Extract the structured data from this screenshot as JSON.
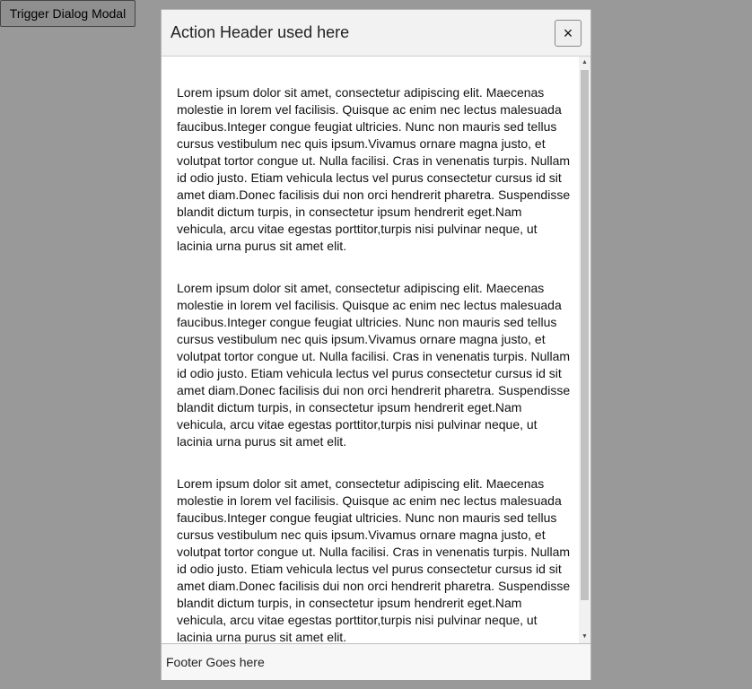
{
  "page": {
    "trigger_label": "Trigger Dialog Modal"
  },
  "modal": {
    "title": "Action Header used here",
    "close_icon": "×",
    "paragraphs": [
      "Lorem ipsum dolor sit amet, consectetur adipiscing elit. Maecenas molestie in lorem vel facilisis. Quisque ac enim nec lectus malesuada faucibus.Integer congue feugiat ultricies. Nunc non mauris sed tellus cursus vestibulum nec quis ipsum.Vivamus ornare magna justo, et volutpat tortor congue ut. Nulla facilisi. Cras in venenatis turpis. Nullam id odio justo. Etiam vehicula lectus vel purus consectetur cursus id sit amet diam.Donec facilisis dui non orci hendrerit pharetra. Suspendisse blandit dictum turpis, in consectetur ipsum hendrerit eget.Nam vehicula, arcu vitae egestas porttitor,turpis nisi pulvinar neque, ut lacinia urna purus sit amet elit.",
      "Lorem ipsum dolor sit amet, consectetur adipiscing elit. Maecenas molestie in lorem vel facilisis. Quisque ac enim nec lectus malesuada faucibus.Integer congue feugiat ultricies. Nunc non mauris sed tellus cursus vestibulum nec quis ipsum.Vivamus ornare magna justo, et volutpat tortor congue ut. Nulla facilisi. Cras in venenatis turpis. Nullam id odio justo. Etiam vehicula lectus vel purus consectetur cursus id sit amet diam.Donec facilisis dui non orci hendrerit pharetra. Suspendisse blandit dictum turpis, in consectetur ipsum hendrerit eget.Nam vehicula, arcu vitae egestas porttitor,turpis nisi pulvinar neque, ut lacinia urna purus sit amet elit.",
      "Lorem ipsum dolor sit amet, consectetur adipiscing elit. Maecenas molestie in lorem vel facilisis. Quisque ac enim nec lectus malesuada faucibus.Integer congue feugiat ultricies. Nunc non mauris sed tellus cursus vestibulum nec quis ipsum.Vivamus ornare magna justo, et volutpat tortor congue ut. Nulla facilisi. Cras in venenatis turpis. Nullam id odio justo. Etiam vehicula lectus vel purus consectetur cursus id sit amet diam.Donec facilisis dui non orci hendrerit pharetra. Suspendisse blandit dictum turpis, in consectetur ipsum hendrerit eget.Nam vehicula, arcu vitae egestas porttitor,turpis nisi pulvinar neque, ut lacinia urna purus sit amet elit."
    ],
    "footer": "Footer Goes here",
    "scrollbar": {
      "up_arrow": "▲",
      "down_arrow": "▼"
    }
  },
  "colors": {
    "overlay": "rgba(0,0,0,0.4)",
    "header_bg": "#f2f2f2",
    "footer_bg": "#f7f7f7"
  }
}
